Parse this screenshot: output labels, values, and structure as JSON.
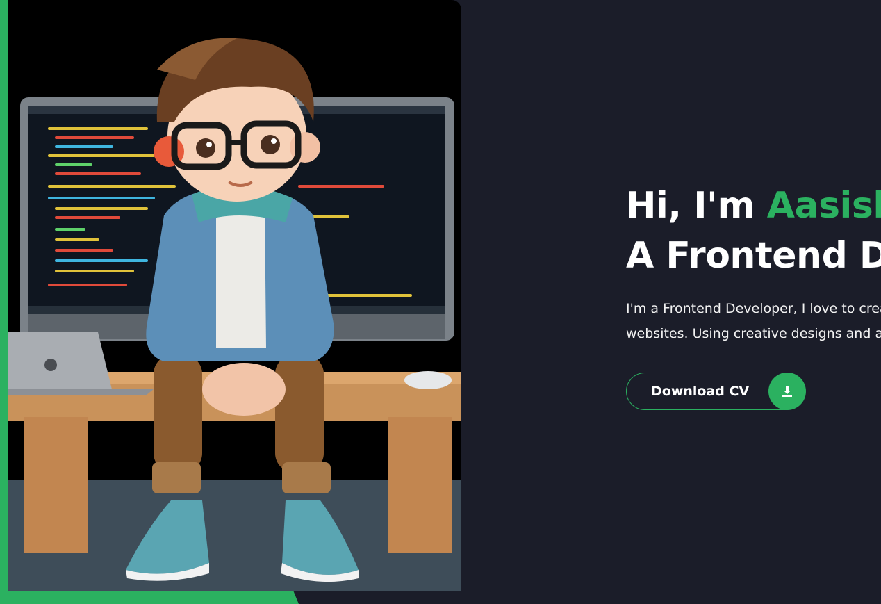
{
  "hero": {
    "image_alt": "3D cartoon developer sitting on a desk in front of a monitor with code"
  },
  "intro": {
    "greeting_prefix": "Hi, I'm ",
    "name": "Aasish",
    "role": "A Frontend De",
    "description_line1": "I'm a Frontend Developer, I love to crea",
    "description_line2": "websites. Using creative designs and a"
  },
  "cta": {
    "download_label": "Download CV",
    "download_icon": "download-icon"
  },
  "colors": {
    "background": "#1b1d29",
    "accent": "#2bb160",
    "text": "#ffffff"
  }
}
